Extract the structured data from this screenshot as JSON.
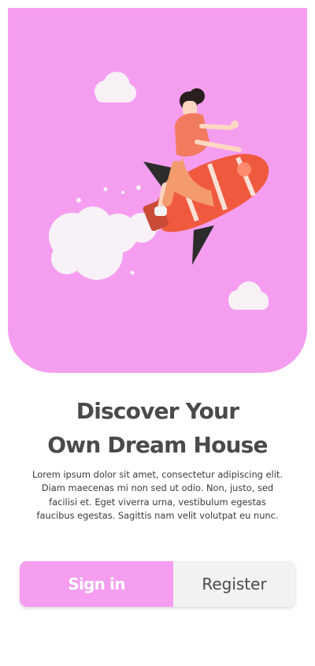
{
  "colors": {
    "accent": "#f59ef0",
    "heading": "#4a4a4a",
    "secondary_button_bg": "#f2f2f2"
  },
  "hero": {
    "illustration": "woman-riding-rocket-illustration"
  },
  "onboarding": {
    "title_line1": "Discover Your",
    "title_line2": "Own Dream House",
    "description": "Lorem ipsum dolor sit amet, consectetur adipiscing elit. Diam maecenas mi non sed ut odio. Non, justo, sed facilisi et. Eget viverra urna, vestibulum egestas faucibus egestas. Sagittis nam velit volutpat eu nunc."
  },
  "auth": {
    "signin_label": "Sign in",
    "register_label": "Register"
  }
}
